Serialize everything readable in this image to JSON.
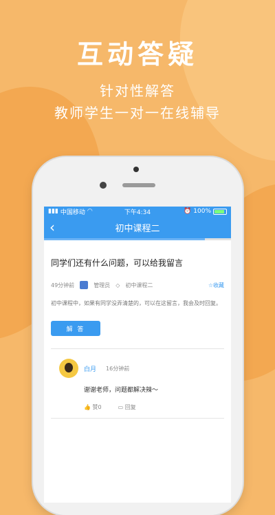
{
  "hero": {
    "title": "互动答疑",
    "subtitle1": "针对性解答",
    "subtitle2": "教师学生一对一在线辅导"
  },
  "status_bar": {
    "carrier": "中国移动",
    "time": "下午4:34",
    "battery": "100%"
  },
  "nav": {
    "back_icon": "‹",
    "title": "初中课程二"
  },
  "question": {
    "title": "同学们还有什么问题，可以给我留言",
    "time": "49分钟前",
    "author": "管理员",
    "course_tag": "初中课程二",
    "favorite_label": "☆收藏",
    "description": "初中课程中，如果有同学没弄清楚的，可以在这留言，我会及时回复。",
    "answer_button": "解 答"
  },
  "reply": {
    "name": "白月",
    "time": "16分钟前",
    "text": "谢谢老师，问题都解决辣～",
    "like": "赞0",
    "reply": "回复"
  },
  "colors": {
    "background": "#f6b86a",
    "accent": "#3a9bf0"
  }
}
